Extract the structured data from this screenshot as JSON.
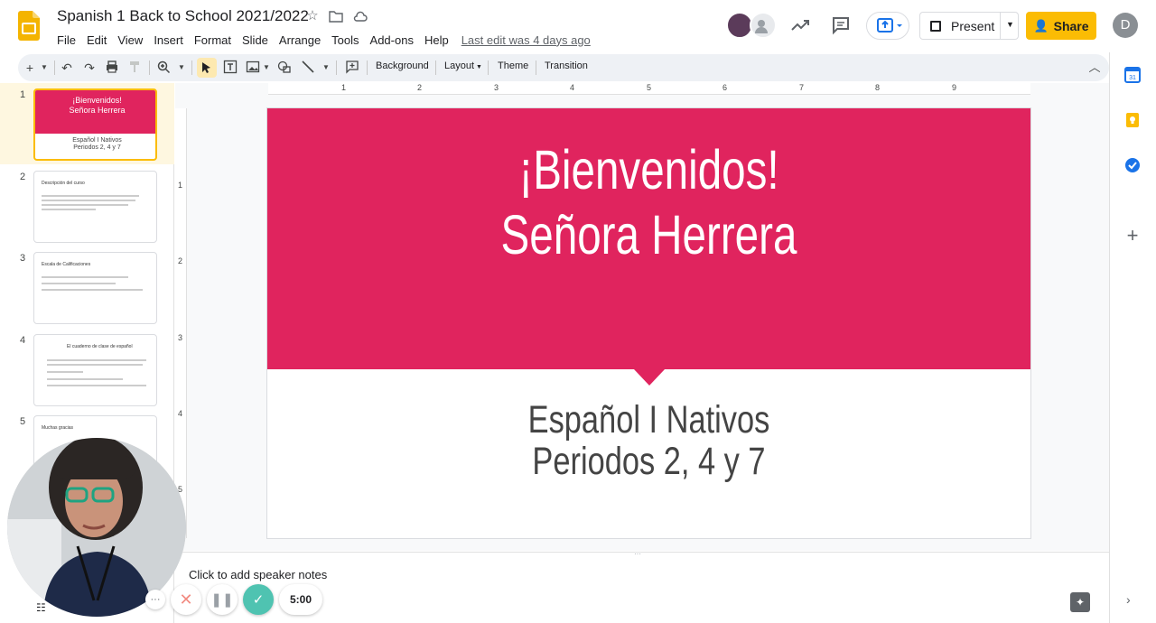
{
  "app": {
    "doc_title": "Spanish 1 Back to School 2021/2022",
    "last_edit": "Last edit was 4 days ago",
    "accent": "#fbbc04",
    "brand_color": "#f4b400"
  },
  "menu": [
    "File",
    "Edit",
    "View",
    "Insert",
    "Format",
    "Slide",
    "Arrange",
    "Tools",
    "Add-ons",
    "Help"
  ],
  "header": {
    "present_label": "Present",
    "share_label": "Share",
    "user_initial": "D"
  },
  "toolbar": {
    "background_label": "Background",
    "layout_label": "Layout",
    "theme_label": "Theme",
    "transition_label": "Transition"
  },
  "ruler": {
    "h": [
      "1",
      "2",
      "3",
      "4",
      "5",
      "6",
      "7",
      "8",
      "9"
    ],
    "v": [
      "1",
      "2",
      "3",
      "4",
      "5"
    ]
  },
  "slides": [
    {
      "num": "1",
      "title": "¡Bienvenidos!",
      "title2": "Señora Herrera",
      "sub1": "Español I Nativos",
      "sub2": "Periodos 2, 4 y 7"
    },
    {
      "num": "2",
      "title": "Descripción del curso"
    },
    {
      "num": "3",
      "title": "Escala de Calificaciones"
    },
    {
      "num": "4",
      "title": "El cuaderno de clase de español"
    },
    {
      "num": "5",
      "title": "Muchas gracias"
    }
  ],
  "slide": {
    "title_line1": "¡Bienvenidos!",
    "title_line2": "Señora Herrera",
    "sub_line1": "Español I Nativos",
    "sub_line2": "Periodos 2, 4 y 7",
    "band_color": "#e0245e"
  },
  "notes": {
    "placeholder": "Click to add speaker notes"
  },
  "recorder": {
    "timer": "5:00"
  }
}
